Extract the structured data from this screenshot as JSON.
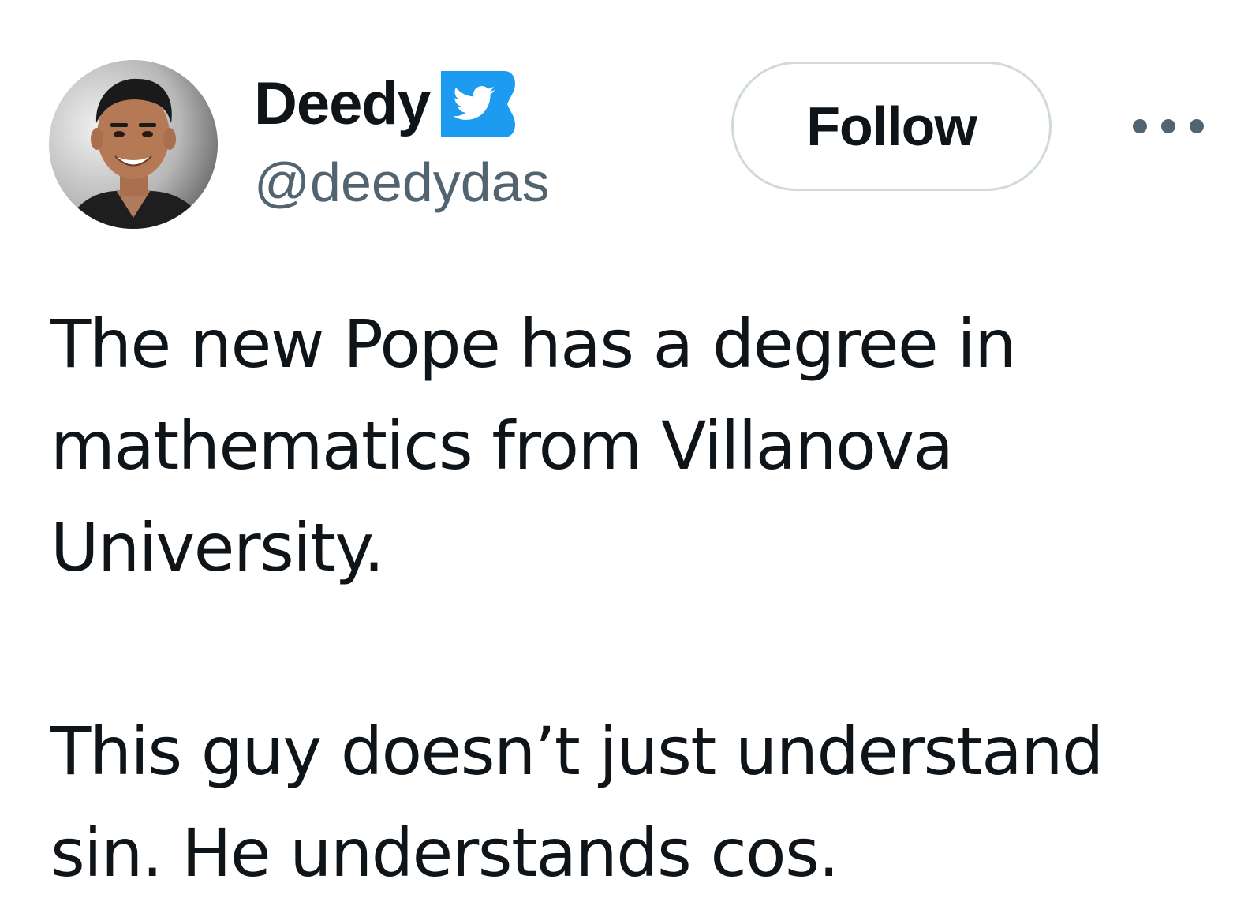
{
  "author": {
    "display_name": "Deedy",
    "handle": "@deedydas",
    "verified_icon": "twitter-bird-verified-icon",
    "avatar": "profile-photo"
  },
  "actions": {
    "follow_label": "Follow",
    "more_icon": "more-horizontal-icon"
  },
  "tweet": {
    "paragraph_1": [
      "The new Pope has a degree in",
      "mathematics from Villanova",
      "University."
    ],
    "paragraph_2": [
      "This guy doesn’t just understand",
      "sin. He understands cos."
    ]
  },
  "colors": {
    "text": "#0f1419",
    "secondary": "#536471",
    "border": "#cfd9de",
    "brand_blue": "#1d9bf0"
  }
}
